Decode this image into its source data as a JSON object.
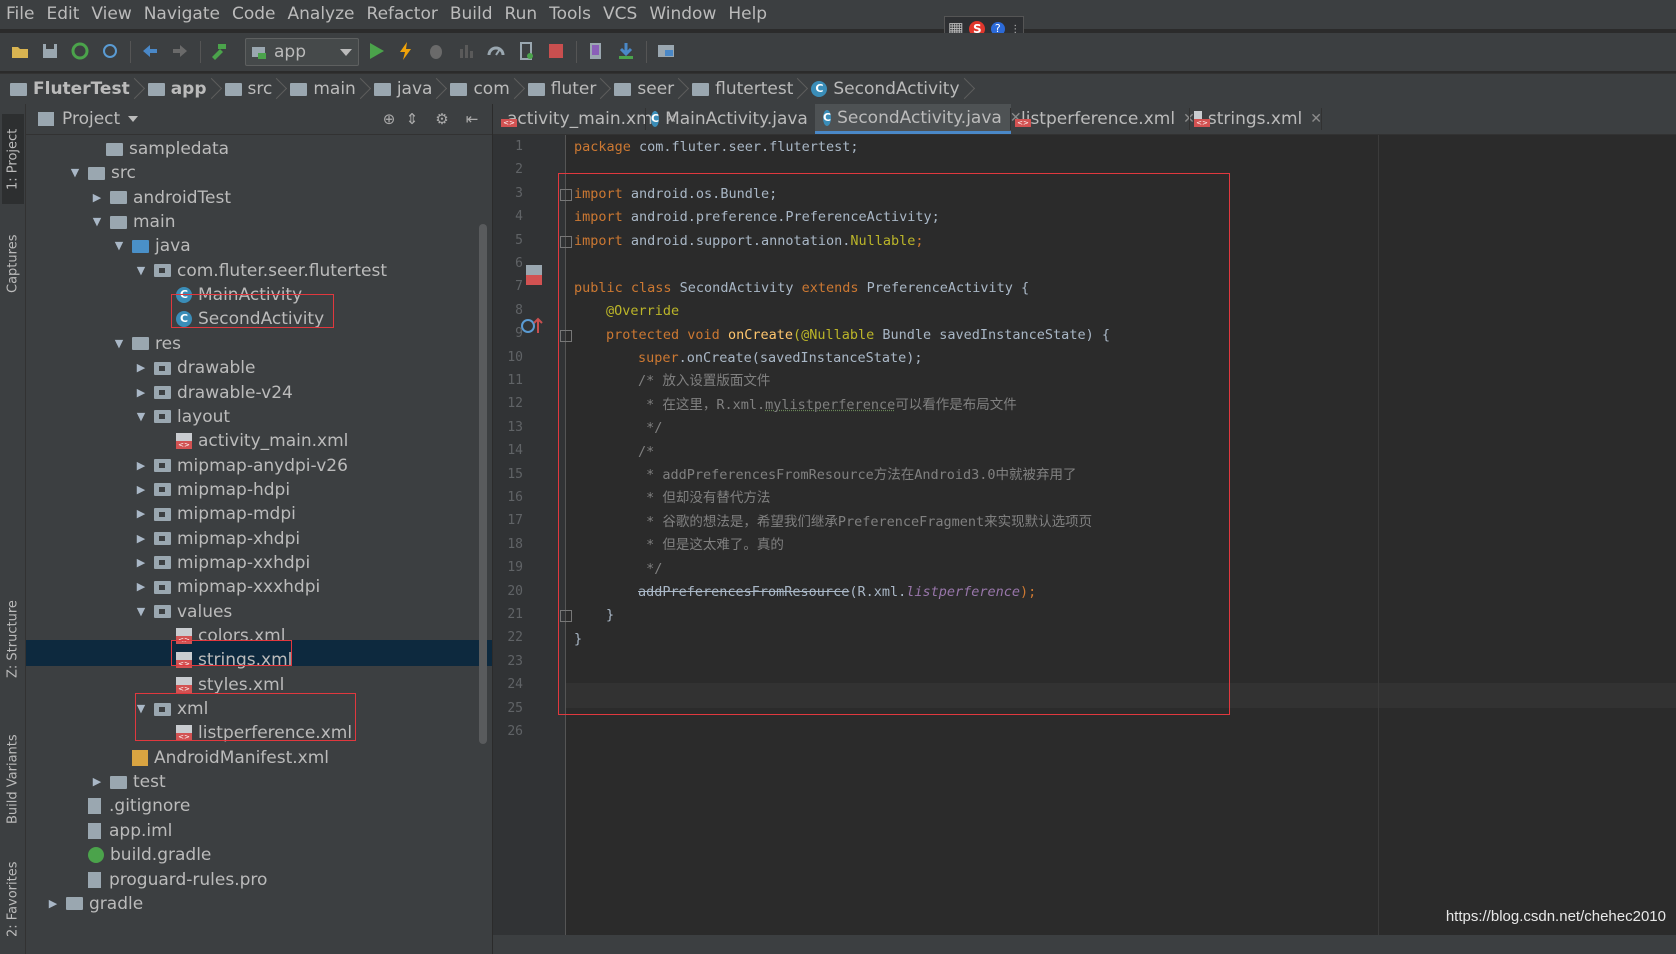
{
  "menu": [
    "File",
    "Edit",
    "View",
    "Navigate",
    "Code",
    "Analyze",
    "Refactor",
    "Build",
    "Run",
    "Tools",
    "VCS",
    "Window",
    "Help"
  ],
  "toolbar": {
    "run_config": "app"
  },
  "breadcrumb": [
    "FluterTest",
    "app",
    "src",
    "main",
    "java",
    "com",
    "fluter",
    "seer",
    "flutertest",
    "SecondActivity"
  ],
  "left_strip": {
    "project": "1: Project",
    "captures": "Captures",
    "structure": "Z: Structure",
    "build_variants": "Build Variants",
    "favorites": "2: Favorites"
  },
  "project_panel": {
    "title": "Project",
    "tree": [
      {
        "label": "sampledata",
        "type": "folder",
        "arrow": ""
      },
      {
        "label": "src",
        "type": "folder",
        "arrow": "▼"
      },
      {
        "label": "androidTest",
        "type": "folder",
        "arrow": "▶"
      },
      {
        "label": "main",
        "type": "folder",
        "arrow": "▼"
      },
      {
        "label": "java",
        "type": "folder-blue",
        "arrow": "▼"
      },
      {
        "label": "com.fluter.seer.flutertest",
        "type": "package",
        "arrow": "▼"
      },
      {
        "label": "MainActivity",
        "type": "class",
        "arrow": ""
      },
      {
        "label": "SecondActivity",
        "type": "class",
        "arrow": ""
      },
      {
        "label": "res",
        "type": "folder",
        "arrow": "▼"
      },
      {
        "label": "drawable",
        "type": "package",
        "arrow": "▶"
      },
      {
        "label": "drawable-v24",
        "type": "package",
        "arrow": "▶"
      },
      {
        "label": "layout",
        "type": "package",
        "arrow": "▼"
      },
      {
        "label": "activity_main.xml",
        "type": "xml",
        "arrow": ""
      },
      {
        "label": "mipmap-anydpi-v26",
        "type": "package",
        "arrow": "▶"
      },
      {
        "label": "mipmap-hdpi",
        "type": "package",
        "arrow": "▶"
      },
      {
        "label": "mipmap-mdpi",
        "type": "package",
        "arrow": "▶"
      },
      {
        "label": "mipmap-xhdpi",
        "type": "package",
        "arrow": "▶"
      },
      {
        "label": "mipmap-xxhdpi",
        "type": "package",
        "arrow": "▶"
      },
      {
        "label": "mipmap-xxxhdpi",
        "type": "package",
        "arrow": "▶"
      },
      {
        "label": "values",
        "type": "package",
        "arrow": "▼"
      },
      {
        "label": "colors.xml",
        "type": "xml",
        "arrow": ""
      },
      {
        "label": "strings.xml",
        "type": "xml",
        "arrow": ""
      },
      {
        "label": "styles.xml",
        "type": "xml",
        "arrow": ""
      },
      {
        "label": "xml",
        "type": "package",
        "arrow": "▼"
      },
      {
        "label": "listperference.xml",
        "type": "xml",
        "arrow": ""
      },
      {
        "label": "AndroidManifest.xml",
        "type": "manifest",
        "arrow": ""
      },
      {
        "label": "test",
        "type": "folder",
        "arrow": "▶"
      },
      {
        "label": ".gitignore",
        "type": "file",
        "arrow": ""
      },
      {
        "label": "app.iml",
        "type": "file",
        "arrow": ""
      },
      {
        "label": "build.gradle",
        "type": "gradle",
        "arrow": ""
      },
      {
        "label": "proguard-rules.pro",
        "type": "file",
        "arrow": ""
      },
      {
        "label": "gradle",
        "type": "folder",
        "arrow": "▶"
      }
    ]
  },
  "editor_tabs": [
    {
      "label": "activity_main.xml",
      "type": "xml",
      "active": false
    },
    {
      "label": "MainActivity.java",
      "type": "class",
      "active": false
    },
    {
      "label": "SecondActivity.java",
      "type": "class",
      "active": true
    },
    {
      "label": "listperference.xml",
      "type": "xml",
      "active": false
    },
    {
      "label": "strings.xml",
      "type": "xml",
      "active": false
    }
  ],
  "code": {
    "l1_kw": "package",
    "l1_rest": " com.fluter.seer.flutertest;",
    "l3_kw": "import",
    "l3_rest": " android.os.Bundle;",
    "l4_kw": "import",
    "l4_rest": " android.preference.PreferenceActivity;",
    "l5_kw": "import",
    "l5_rest": " android.support.annotation.",
    "l5_ann": "Nullable",
    "l5_end": ";",
    "l7_kw1": "public class",
    "l7_name": " SecondActivity ",
    "l7_kw2": "extends",
    "l7_rest": " PreferenceActivity {",
    "l8_ann": "@Override",
    "l9_kw": "protected void",
    "l9_fn": "onCreate",
    "l9_ann": "(@Nullable",
    "l9_rest": " Bundle savedInstanceState) {",
    "l10_kw": "super",
    "l10_rest": ".onCreate(savedInstanceState);",
    "l11": "/* 放入设置版面文件",
    "l12_a": " * 在这里，R.xml.",
    "l12_u": "mylistperference",
    "l12_b": "可以看作是布局文件",
    "l13": " */",
    "l14": "/*",
    "l15": " * addPreferencesFromResource方法在Android3.0中就被弃用了",
    "l16": " * 但却没有替代方法",
    "l17": " * 谷歌的想法是，希望我们继承PreferenceFragment来实现默认选项页",
    "l18": " * 但是这太难了。真的",
    "l19": " */",
    "l20_strike": "addPreferencesFromResource",
    "l20_a": "(R.xml.",
    "l20_it": "listperference",
    "l20_b": ");",
    "l21": "}",
    "l22": "}"
  },
  "line_numbers": [
    "1",
    "2",
    "3",
    "4",
    "5",
    "6",
    "7",
    "8",
    "9",
    "10",
    "11",
    "12",
    "13",
    "14",
    "15",
    "16",
    "17",
    "18",
    "19",
    "20",
    "21",
    "22",
    "23",
    "24",
    "25",
    "26"
  ],
  "watermark": "https://blog.csdn.net/chehec2010"
}
